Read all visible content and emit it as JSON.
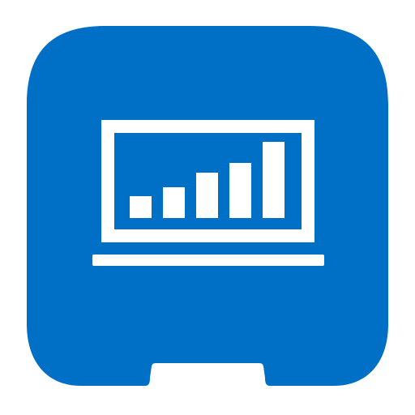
{
  "icon": {
    "name": "laptop-bar-chart-app-icon",
    "tile_color": "#0070c6",
    "glyph_color": "#ffffff",
    "glyph": "laptop-bar-chart-icon",
    "bar_levels": [
      0.29,
      0.4,
      0.6,
      0.72,
      1.0
    ]
  }
}
